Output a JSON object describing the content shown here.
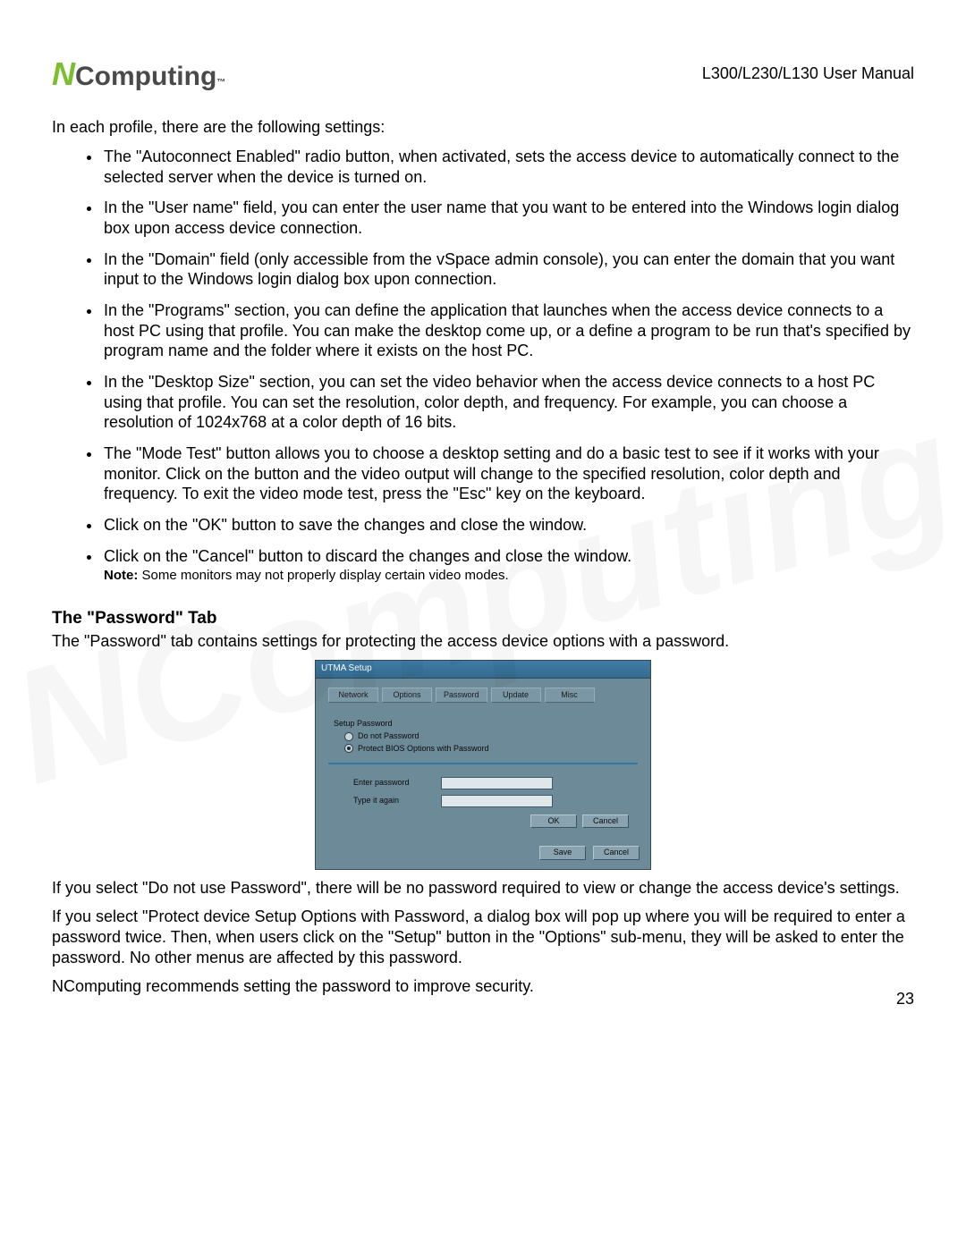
{
  "header": {
    "logo_n": "N",
    "logo_rest": "Computing",
    "logo_tm": "™",
    "manual_title": "L300/L230/L130 User Manual"
  },
  "watermark": "NComputing",
  "intro": "In each profile, there are the following settings:",
  "bullets": [
    "The \"Autoconnect Enabled\" radio button, when activated, sets the access device to automatically connect to the selected server when the device is turned on.",
    "In the \"User name\" field, you can enter the user name that you want to be entered into the Windows login dialog box upon access device connection.",
    "In the \"Domain\" field (only accessible from the vSpace admin console), you can enter the domain that you want input to the Windows login dialog box upon connection.",
    "In the \"Programs\" section, you can define the application that launches when the access device connects to a host PC using that profile. You can make the desktop come up, or a define a program to be run that's specified by program name and the folder where it exists on the host PC.",
    "In the \"Desktop Size\" section, you can set the video behavior when the access device connects to a host PC using that profile. You can set the resolution, color depth, and frequency. For example, you can choose a resolution of 1024x768 at a color depth of 16 bits.",
    "The \"Mode Test\" button allows you to choose a desktop setting and do a basic test to see if it works with your monitor. Click on the button and the video output will change to the specified resolution, color depth and frequency. To exit the video mode test, press the \"Esc\" key on the keyboard.",
    "Click on the \"OK\" button to save the changes and close the window.",
    "Click on the \"Cancel\" button to discard the changes and close the window."
  ],
  "note_label": "Note:",
  "note_text": " Some monitors may not properly display certain video modes.",
  "section_heading": "The \"Password\" Tab",
  "section_intro": "The \"Password\" tab contains settings for protecting the access device options with a password.",
  "utma": {
    "title": "UTMA Setup",
    "tabs": [
      "Network",
      "Options",
      "Password",
      "Update",
      "Misc"
    ],
    "group_legend": "Setup Password",
    "radio1": "Do not Password",
    "radio2": "Protect BIOS Options with Password",
    "enter_label": "Enter password",
    "again_label": "Type it again",
    "ok": "OK",
    "cancel_inner": "Cancel",
    "save": "Save",
    "cancel_outer": "Cancel"
  },
  "after1": "If you select \"Do not use Password\", there will be no password required to view or change the access device's settings.",
  "after2": "If you select \"Protect device Setup Options with Password, a dialog box will pop up where you will be required to enter a password twice. Then, when users click on the \"Setup\" button in the \"Options\" sub-menu, they will be asked to enter the password. No other menus are affected by this password.",
  "after3": "NComputing recommends setting the password to improve security.",
  "page_number": "23"
}
